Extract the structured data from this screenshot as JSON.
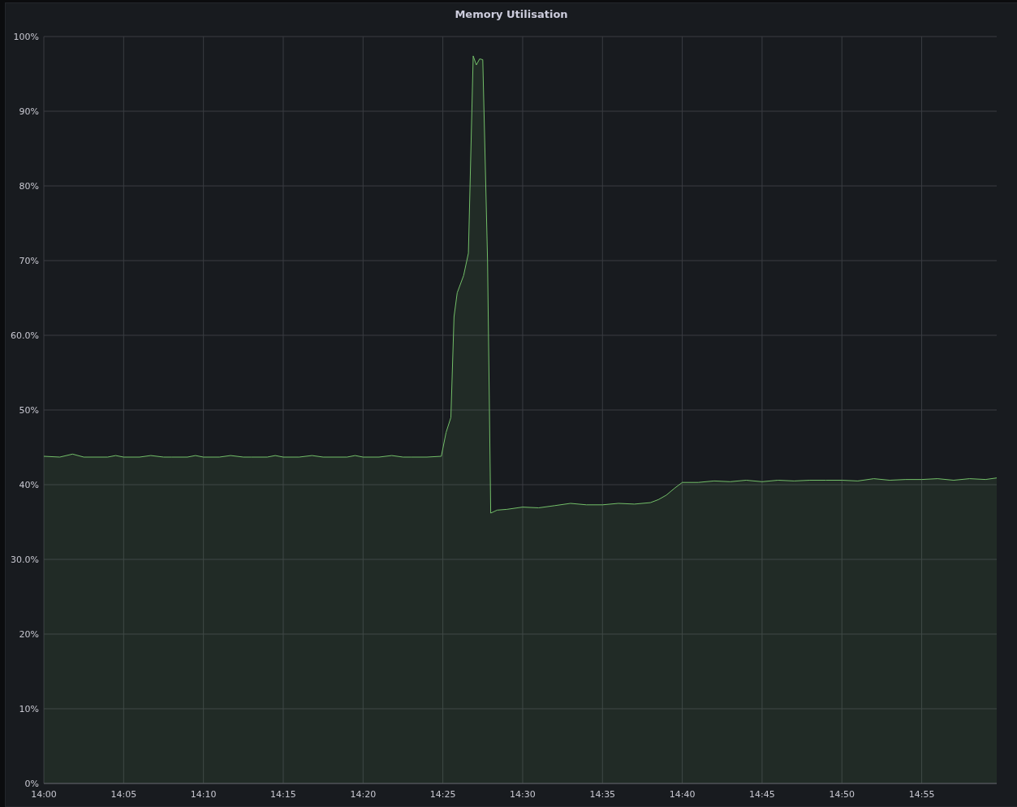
{
  "panel": {
    "title": "Memory Utilisation",
    "chart_data": {
      "type": "area",
      "x": [
        840,
        841,
        841.8,
        842.5,
        843,
        844,
        844.5,
        845,
        846,
        846.7,
        847.5,
        848,
        849,
        849.5,
        850,
        851,
        851.7,
        852.5,
        853,
        854,
        854.5,
        855,
        856,
        856.8,
        857.5,
        858,
        859,
        859.5,
        860,
        861,
        861.8,
        862.5,
        863,
        864,
        864.9,
        865.2,
        865.5,
        865.7,
        865.9,
        866.3,
        866.6,
        866.9,
        867.1,
        867.3,
        867.5,
        867.8,
        868.0,
        868.4,
        869,
        870,
        871,
        872,
        873,
        874,
        875,
        876,
        877,
        878,
        878.5,
        879,
        879.5,
        880,
        881,
        882,
        883,
        884,
        885,
        886,
        887,
        888,
        889,
        890,
        891,
        892,
        893,
        894,
        895,
        896,
        897,
        898,
        899,
        899.7
      ],
      "series": [
        {
          "color": "#73bf69",
          "values": [
            43.8,
            43.7,
            44.1,
            43.7,
            43.7,
            43.7,
            43.9,
            43.7,
            43.7,
            43.9,
            43.7,
            43.7,
            43.7,
            43.9,
            43.7,
            43.7,
            43.9,
            43.7,
            43.7,
            43.7,
            43.9,
            43.7,
            43.7,
            43.9,
            43.7,
            43.7,
            43.7,
            43.9,
            43.7,
            43.7,
            43.9,
            43.7,
            43.7,
            43.7,
            43.8,
            47.0,
            49.0,
            62.5,
            65.7,
            68.0,
            71.0,
            97.4,
            96.2,
            97.0,
            96.9,
            70.0,
            36.2,
            36.6,
            36.7,
            37.0,
            36.9,
            37.2,
            37.5,
            37.3,
            37.3,
            37.5,
            37.4,
            37.6,
            38.0,
            38.6,
            39.5,
            40.3,
            40.3,
            40.5,
            40.4,
            40.6,
            40.4,
            40.6,
            40.5,
            40.6,
            40.6,
            40.6,
            40.5,
            40.8,
            40.6,
            40.7,
            40.7,
            40.8,
            40.6,
            40.8,
            40.7,
            40.9
          ]
        }
      ],
      "grid": true,
      "xlim": [
        840,
        899.7
      ],
      "ylim": [
        0,
        100
      ],
      "xticks": [
        {
          "value": 840,
          "label": "14:00"
        },
        {
          "value": 845,
          "label": "14:05"
        },
        {
          "value": 850,
          "label": "14:10"
        },
        {
          "value": 855,
          "label": "14:15"
        },
        {
          "value": 860,
          "label": "14:20"
        },
        {
          "value": 865,
          "label": "14:25"
        },
        {
          "value": 870,
          "label": "14:30"
        },
        {
          "value": 875,
          "label": "14:35"
        },
        {
          "value": 880,
          "label": "14:40"
        },
        {
          "value": 885,
          "label": "14:45"
        },
        {
          "value": 890,
          "label": "14:50"
        },
        {
          "value": 895,
          "label": "14:55"
        }
      ],
      "yticks": [
        {
          "value": 0,
          "label": "0%"
        },
        {
          "value": 10,
          "label": "10%"
        },
        {
          "value": 20,
          "label": "20%"
        },
        {
          "value": 30,
          "label": "30.0%"
        },
        {
          "value": 40,
          "label": "40%"
        },
        {
          "value": 50,
          "label": "50%"
        },
        {
          "value": 60,
          "label": "60.0%"
        },
        {
          "value": 70,
          "label": "70%"
        },
        {
          "value": 80,
          "label": "80%"
        },
        {
          "value": 90,
          "label": "90%"
        },
        {
          "value": 100,
          "label": "100%"
        }
      ]
    }
  }
}
